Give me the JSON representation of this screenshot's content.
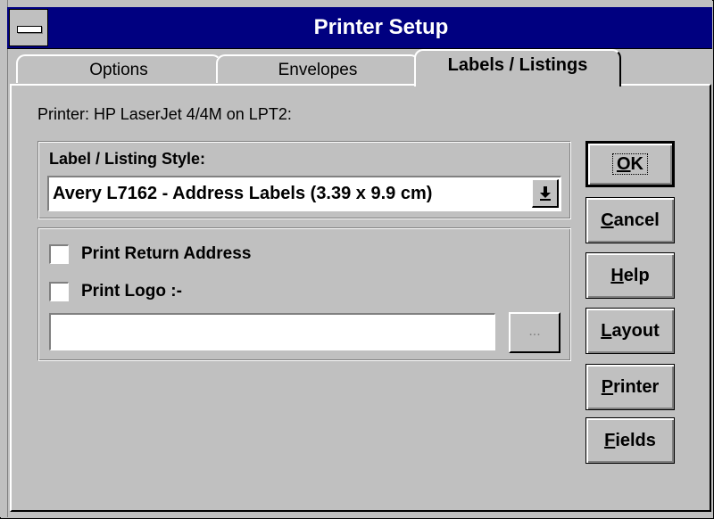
{
  "window": {
    "title": "Printer Setup"
  },
  "tabs": [
    {
      "label": "Options"
    },
    {
      "label": "Envelopes"
    },
    {
      "label": "Labels / Listings"
    }
  ],
  "printer": {
    "label": "Printer:",
    "value": "HP LaserJet 4/4M on LPT2:"
  },
  "style_group": {
    "label": "Label / Listing Style:",
    "selected": "Avery L7162 - Address Labels (3.39 x 9.9 cm)"
  },
  "options": {
    "print_return_address": {
      "label": "Print Return Address",
      "checked": false
    },
    "print_logo": {
      "label": "Print Logo :-",
      "checked": false
    },
    "logo_path": {
      "value": ""
    },
    "browse_label": "..."
  },
  "buttons": {
    "ok": {
      "mnemonic": "O",
      "rest": "K"
    },
    "cancel": {
      "mnemonic": "C",
      "rest": "ancel"
    },
    "help": {
      "mnemonic": "H",
      "rest": "elp"
    },
    "layout": {
      "mnemonic": "L",
      "rest": "ayout"
    },
    "printer": {
      "mnemonic": "P",
      "rest": "rinter"
    },
    "fields": {
      "mnemonic": "F",
      "rest": "ields"
    }
  }
}
